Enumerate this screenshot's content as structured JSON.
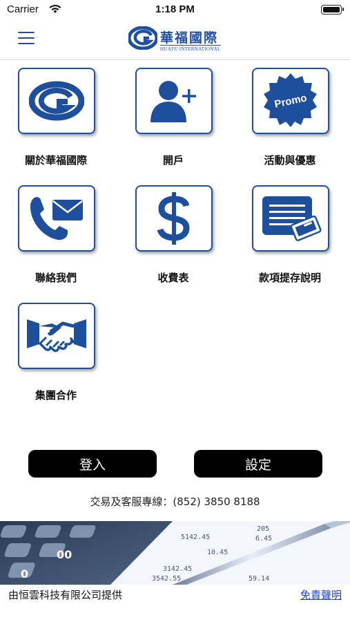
{
  "status_bar": {
    "carrier": "Carrier",
    "time": "1:18 PM"
  },
  "header": {
    "logo_cn": "華福國際",
    "logo_en": "HUAFU INTERNATIONAL"
  },
  "tiles": [
    {
      "label": "關於華福國際",
      "icon": "huafu-logo-icon"
    },
    {
      "label": "開戶",
      "icon": "add-user-icon"
    },
    {
      "label": "活動與優惠",
      "icon": "promo-badge-icon",
      "badge_text": "Promo"
    },
    {
      "label": "聯絡我們",
      "icon": "phone-mail-icon"
    },
    {
      "label": "收費表",
      "icon": "dollar-icon"
    },
    {
      "label": "款項提存說明",
      "icon": "document-ticket-icon"
    },
    {
      "label": "集團合作",
      "icon": "handshake-icon"
    }
  ],
  "buttons": {
    "login": "登入",
    "settings": "設定"
  },
  "hotline": "交易及客服專線：(852) 3850 8188",
  "banner": {
    "numbers": [
      "205",
      "6.45",
      "5142.45",
      "3142.45",
      "3542.55",
      "59.14",
      "10.45",
      "00",
      "0"
    ]
  },
  "footer": {
    "provider": "由恒雲科技有限公司提供",
    "disclaimer": "免責聲明"
  },
  "colors": {
    "brand_blue": "#1e4f9c",
    "button_black": "#000000",
    "link_blue": "#1a3ed6"
  }
}
